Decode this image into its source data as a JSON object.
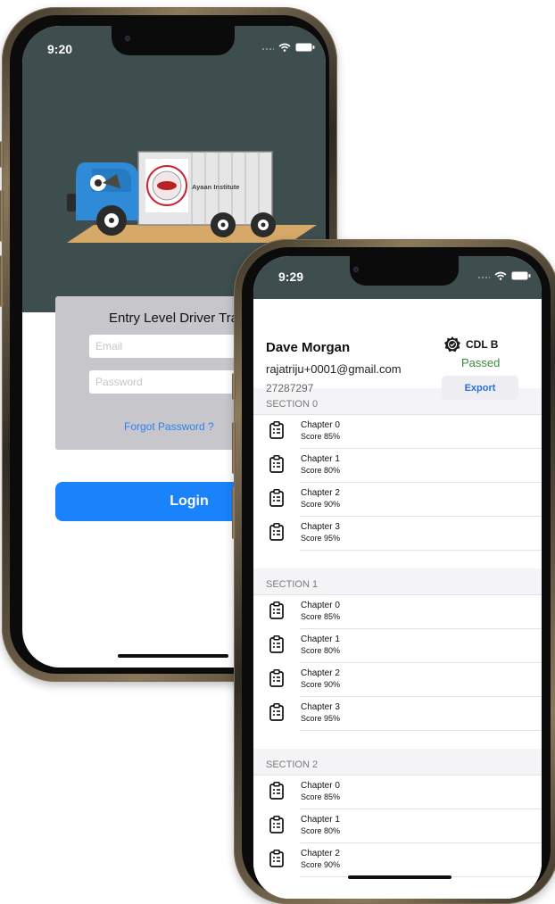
{
  "login_screen": {
    "status_time": "9:20",
    "truck_sign": "Ayaan Institute",
    "card_title": "Entry Level Driver Training",
    "email_placeholder": "Email",
    "password_placeholder": "Password",
    "forgot_label": "Forgot Password ?",
    "login_label": "Login"
  },
  "results_screen": {
    "status_time": "9:29",
    "user": {
      "name": "Dave Morgan",
      "email": "rajatriju+0001@gmail.com",
      "id": "27287297"
    },
    "license": {
      "class": "CDL B",
      "status": "Passed",
      "export_label": "Export"
    },
    "sections": [
      {
        "label": "SECTION 0",
        "chapters": [
          {
            "name": "Chapter 0",
            "score": "Score 85%"
          },
          {
            "name": "Chapter 1",
            "score": "Score 80%"
          },
          {
            "name": "Chapter 2",
            "score": "Score 90%"
          },
          {
            "name": "Chapter 3",
            "score": "Score 95%"
          }
        ]
      },
      {
        "label": "SECTION 1",
        "chapters": [
          {
            "name": "Chapter 0",
            "score": "Score 85%"
          },
          {
            "name": "Chapter 1",
            "score": "Score 80%"
          },
          {
            "name": "Chapter 2",
            "score": "Score 90%"
          },
          {
            "name": "Chapter 3",
            "score": "Score 95%"
          }
        ]
      },
      {
        "label": "SECTION 2",
        "chapters": [
          {
            "name": "Chapter 0",
            "score": "Score 85%"
          },
          {
            "name": "Chapter 1",
            "score": "Score 80%"
          },
          {
            "name": "Chapter 2",
            "score": "Score 90%"
          }
        ]
      }
    ]
  },
  "colors": {
    "header_bg": "#3e4d4d",
    "login_button": "#1a82fb",
    "passed": "#3a8b3a",
    "link": "#2d7ff0"
  }
}
